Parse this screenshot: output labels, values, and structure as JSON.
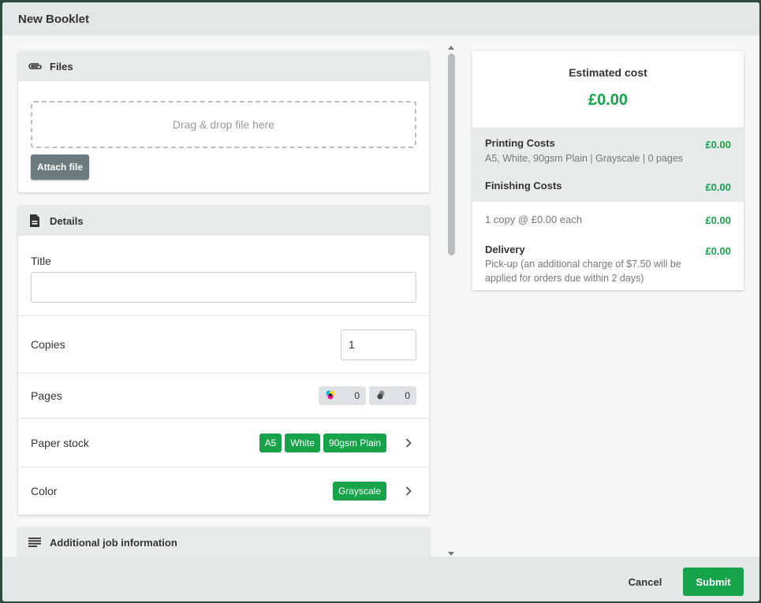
{
  "modal": {
    "title": "New Booklet"
  },
  "files": {
    "heading": "Files",
    "dropzone_text": "Drag & drop file here",
    "attach_label": "Attach file"
  },
  "details": {
    "heading": "Details",
    "title_label": "Title",
    "title_value": "",
    "copies_label": "Copies",
    "copies_value": "1",
    "pages_label": "Pages",
    "pages_color_count": "0",
    "pages_grayscale_count": "0",
    "paper_stock_label": "Paper stock",
    "paper_stock_tags": [
      "A5",
      "White",
      "90gsm Plain"
    ],
    "color_label": "Color",
    "color_tag": "Grayscale"
  },
  "additional": {
    "heading": "Additional job information"
  },
  "estimate": {
    "label": "Estimated cost",
    "total": "£0.00",
    "printing_title": "Printing Costs",
    "printing_sub": "A5, White, 90gsm Plain | Grayscale | 0 pages",
    "printing_value": "£0.00",
    "finishing_title": "Finishing Costs",
    "finishing_value": "£0.00",
    "per_copy_text": "1 copy @ £0.00 each",
    "per_copy_value": "£0.00",
    "delivery_title": "Delivery",
    "delivery_sub": "Pick-up (an additional charge of $7.50 will be applied for orders due within 2 days)",
    "delivery_value": "£0.00"
  },
  "footer": {
    "cancel_label": "Cancel",
    "submit_label": "Submit"
  },
  "colors": {
    "accent": "#17a34a",
    "header_bg": "#e4e7e8",
    "button_gray": "#6b7c80"
  }
}
